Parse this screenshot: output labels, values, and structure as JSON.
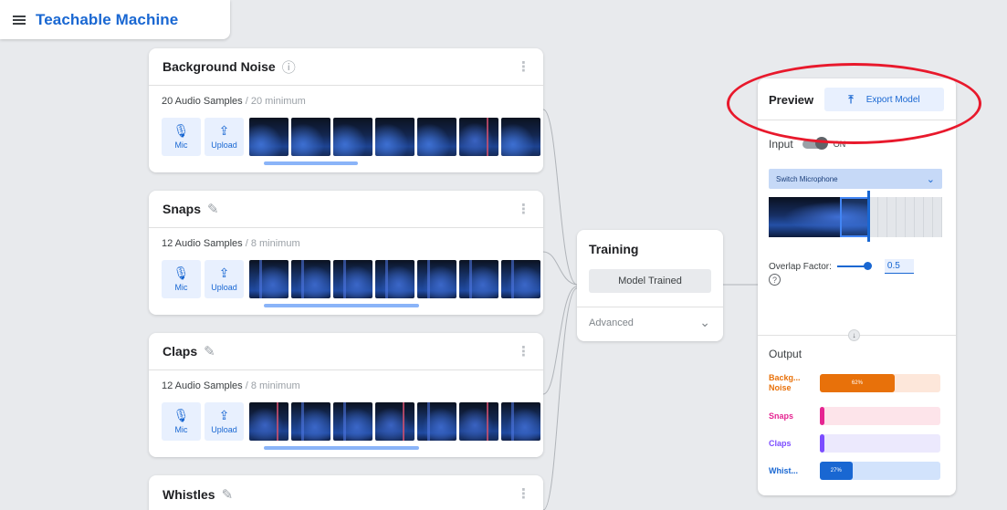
{
  "app": {
    "title": "Teachable Machine"
  },
  "classes": [
    {
      "name": "Background Noise",
      "title_icon": "help-icon",
      "sample_count": "20 Audio Samples",
      "sample_min": " / 20 minimum",
      "mic_label": "Mic",
      "upload_label": "Upload"
    },
    {
      "name": "Snaps",
      "title_icon": "pencil-icon",
      "sample_count": "12 Audio Samples",
      "sample_min": " / 8 minimum",
      "mic_label": "Mic",
      "upload_label": "Upload"
    },
    {
      "name": "Claps",
      "title_icon": "pencil-icon",
      "sample_count": "12 Audio Samples",
      "sample_min": " / 8 minimum",
      "mic_label": "Mic",
      "upload_label": "Upload"
    },
    {
      "name": "Whistles",
      "title_icon": "pencil-icon"
    }
  ],
  "training": {
    "title": "Training",
    "button_label": "Model Trained",
    "advanced_label": "Advanced"
  },
  "preview": {
    "title": "Preview",
    "export_label": "Export Model",
    "input_label": "Input",
    "input_state": "ON",
    "mic_select": "Switch Microphone",
    "overlap_label": "Overlap Factor:",
    "overlap_value": "0.5",
    "output_title": "Output",
    "outputs": [
      {
        "label": "Backg... Noise",
        "percent": 62,
        "percent_text": "62%",
        "color": "#e8710a",
        "track": "#fde7da"
      },
      {
        "label": "Snaps",
        "percent": 2,
        "percent_text": "",
        "color": "#e52592",
        "track": "#fde4ea"
      },
      {
        "label": "Claps",
        "percent": 2,
        "percent_text": "",
        "color": "#7c4dff",
        "track": "#ece9fd"
      },
      {
        "label": "Whist...",
        "percent": 27,
        "percent_text": "27%",
        "color": "#1967d2",
        "track": "#d2e3fc"
      }
    ]
  },
  "colors": {
    "brand": "#1967d2",
    "annotation": "#e8192c",
    "background": "#e8eaed"
  }
}
